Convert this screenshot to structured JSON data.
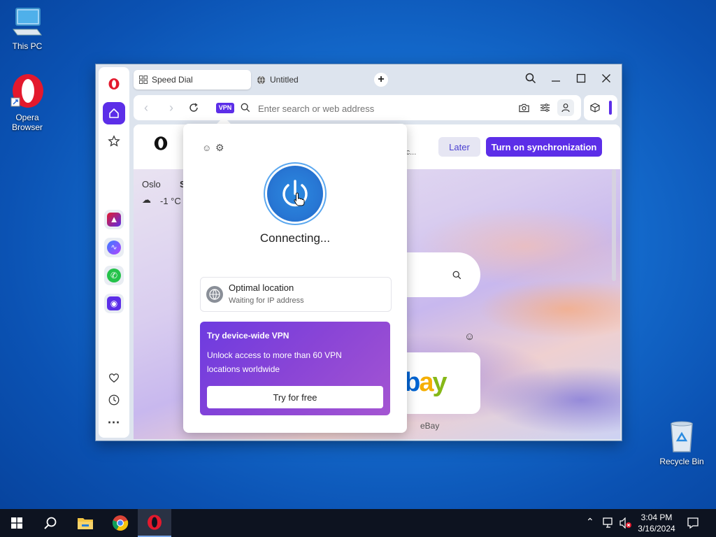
{
  "desktop": {
    "icons": [
      {
        "label": "This PC"
      },
      {
        "label": "Opera Browser"
      },
      {
        "label": "Recycle Bin"
      }
    ]
  },
  "browser": {
    "tabs": [
      {
        "label": "Speed Dial",
        "active": true
      },
      {
        "label": "Untitled",
        "active": false
      }
    ],
    "address": {
      "placeholder": "Enter search or web address",
      "vpn_badge": "VPN"
    },
    "sync": {
      "later_label": "Later",
      "turn_on_label": "Turn on synchronization",
      "account_snippet": "acc..."
    },
    "weather": {
      "city": "Oslo",
      "temp": "-1 °C",
      "extra": "S"
    },
    "speed_dial": {
      "ebay_label": "eBay",
      "ebay_logo": "ebay"
    }
  },
  "vpn_popup": {
    "status": "Connecting...",
    "location_title": "Optimal location",
    "location_sub": "Waiting for IP address",
    "promo_title": "Try device-wide VPN",
    "promo_body": "Unlock access to more than 60 VPN locations worldwide",
    "promo_button": "Try for free"
  },
  "taskbar": {
    "time": "3:04 PM",
    "date": "3/16/2024"
  },
  "colors": {
    "accent": "#5c2ee8",
    "opera_red": "#e3192d",
    "vpn_blue": "#2b82de"
  }
}
